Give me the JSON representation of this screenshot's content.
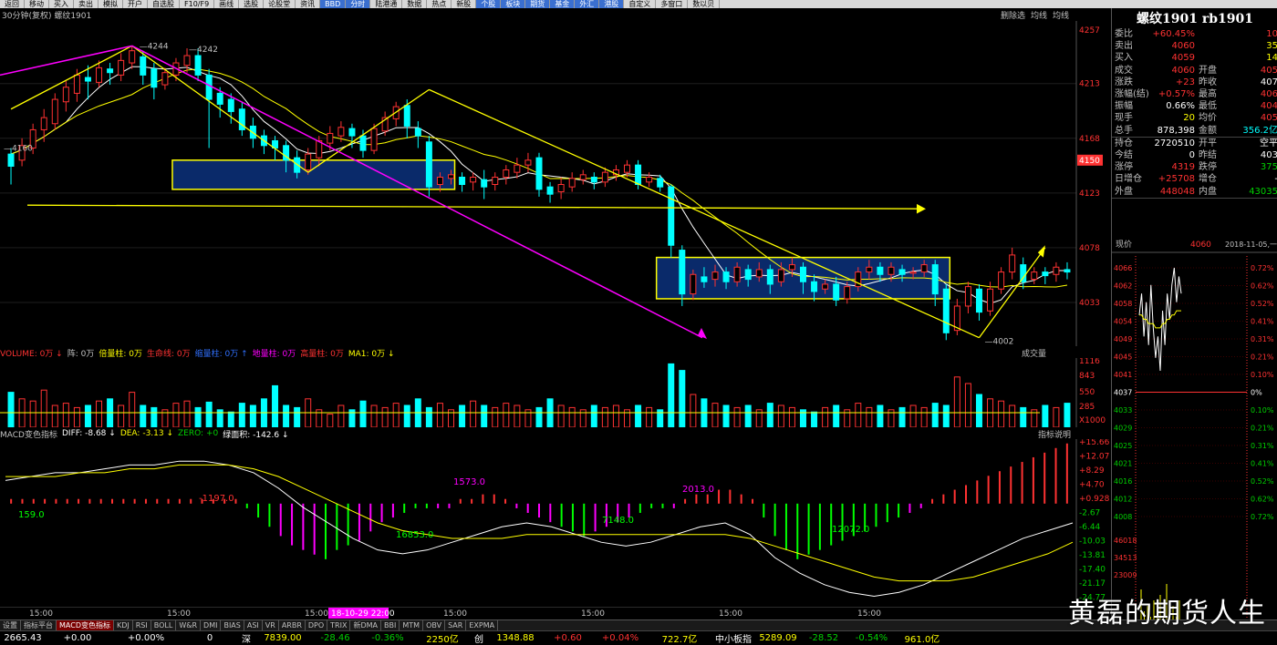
{
  "toolbar": {
    "items": [
      "返回",
      "移动",
      "买入",
      "卖出",
      "模拟",
      "开户",
      "自选股",
      "F10/F9",
      "画线",
      "选股",
      "论股堂",
      "资讯",
      "BBD",
      "分时",
      "陆港通",
      "数据",
      "热点",
      "新股",
      "个股",
      "板块",
      "期货",
      "基金",
      "外汇",
      "港股",
      "自定义",
      "多窗口",
      "数以贝"
    ],
    "highlight": [
      "BBD",
      "分时",
      "个股",
      "板块",
      "期货",
      "基金",
      "外汇",
      "港股"
    ]
  },
  "chart_header": {
    "title": "30分钟(复权)  螺纹1901",
    "right": [
      "删除选",
      "均线",
      "均线"
    ]
  },
  "price_axis": {
    "ticks": [
      "4257",
      "4213",
      "4168",
      "4150",
      "4123",
      "4078",
      "4033"
    ],
    "current": "4150"
  },
  "kline": {
    "labels": {
      "hi1": "4244",
      "hi2": "4242",
      "lo1": "4160",
      "lo2": "4002"
    },
    "candles": [
      [
        4145,
        4155,
        4130,
        4160,
        "d"
      ],
      [
        4150,
        4162,
        4145,
        4168,
        "u"
      ],
      [
        4160,
        4175,
        4155,
        4180,
        "u"
      ],
      [
        4175,
        4185,
        4165,
        4192,
        "u"
      ],
      [
        4180,
        4200,
        4175,
        4205,
        "u"
      ],
      [
        4198,
        4210,
        4190,
        4215,
        "u"
      ],
      [
        4205,
        4220,
        4198,
        4225,
        "u"
      ],
      [
        4215,
        4218,
        4200,
        4228,
        "d"
      ],
      [
        4214,
        4226,
        4210,
        4232,
        "u"
      ],
      [
        4222,
        4225,
        4212,
        4230,
        "d"
      ],
      [
        4220,
        4232,
        4215,
        4238,
        "u"
      ],
      [
        4230,
        4240,
        4225,
        4244,
        "u"
      ],
      [
        4235,
        4220,
        4212,
        4240,
        "d"
      ],
      [
        4225,
        4210,
        4200,
        4230,
        "d"
      ],
      [
        4212,
        4222,
        4208,
        4226,
        "u"
      ],
      [
        4220,
        4230,
        4215,
        4234,
        "u"
      ],
      [
        4228,
        4236,
        4222,
        4242,
        "u"
      ],
      [
        4236,
        4220,
        4215,
        4242,
        "d"
      ],
      [
        4220,
        4200,
        4160,
        4225,
        "d"
      ],
      [
        4205,
        4196,
        4185,
        4210,
        "d"
      ],
      [
        4200,
        4190,
        4180,
        4205,
        "d"
      ],
      [
        4192,
        4175,
        4170,
        4198,
        "d"
      ],
      [
        4178,
        4168,
        4160,
        4185,
        "d"
      ],
      [
        4170,
        4162,
        4155,
        4175,
        "d"
      ],
      [
        4166,
        4160,
        4150,
        4170,
        "d"
      ],
      [
        4162,
        4150,
        4140,
        4166,
        "d"
      ],
      [
        4152,
        4140,
        4135,
        4158,
        "d"
      ],
      [
        4142,
        4155,
        4138,
        4160,
        "u"
      ],
      [
        4152,
        4166,
        4145,
        4170,
        "u"
      ],
      [
        4164,
        4172,
        4158,
        4178,
        "u"
      ],
      [
        4170,
        4177,
        4165,
        4182,
        "u"
      ],
      [
        4176,
        4170,
        4160,
        4180,
        "d"
      ],
      [
        4170,
        4158,
        4152,
        4175,
        "d"
      ],
      [
        4158,
        4176,
        4155,
        4180,
        "u"
      ],
      [
        4174,
        4185,
        4170,
        4190,
        "u"
      ],
      [
        4184,
        4194,
        4178,
        4198,
        "u"
      ],
      [
        4195,
        4178,
        4168,
        4200,
        "d"
      ],
      [
        4176,
        4170,
        4160,
        4182,
        "d"
      ],
      [
        4165,
        4128,
        4120,
        4170,
        "d"
      ],
      [
        4130,
        4136,
        4124,
        4140,
        "u"
      ],
      [
        4135,
        4138,
        4130,
        4142,
        "u"
      ],
      [
        4136,
        4130,
        4124,
        4140,
        "d"
      ],
      [
        4132,
        4136,
        4125,
        4140,
        "u"
      ],
      [
        4134,
        4128,
        4118,
        4142,
        "d"
      ],
      [
        4130,
        4136,
        4125,
        4140,
        "u"
      ],
      [
        4136,
        4142,
        4130,
        4146,
        "u"
      ],
      [
        4140,
        4146,
        4135,
        4152,
        "u"
      ],
      [
        4146,
        4150,
        4140,
        4156,
        "u"
      ],
      [
        4152,
        4126,
        4120,
        4156,
        "d"
      ],
      [
        4128,
        4122,
        4115,
        4132,
        "d"
      ],
      [
        4124,
        4130,
        4118,
        4136,
        "u"
      ],
      [
        4128,
        4135,
        4124,
        4140,
        "u"
      ],
      [
        4134,
        4138,
        4130,
        4142,
        "u"
      ],
      [
        4136,
        4132,
        4126,
        4140,
        "d"
      ],
      [
        4132,
        4140,
        4128,
        4144,
        "u"
      ],
      [
        4138,
        4142,
        4133,
        4146,
        "u"
      ],
      [
        4140,
        4146,
        4136,
        4150,
        "u"
      ],
      [
        4146,
        4130,
        4126,
        4150,
        "d"
      ],
      [
        4132,
        4136,
        4128,
        4140,
        "u"
      ],
      [
        4135,
        4128,
        4124,
        4138,
        "d"
      ],
      [
        4128,
        4080,
        4070,
        4130,
        "d"
      ],
      [
        4076,
        4040,
        4030,
        4080,
        "d"
      ],
      [
        4040,
        4056,
        4035,
        4060,
        "u"
      ],
      [
        4054,
        4050,
        4045,
        4062,
        "d"
      ],
      [
        4052,
        4058,
        4046,
        4064,
        "u"
      ],
      [
        4058,
        4050,
        4044,
        4062,
        "d"
      ],
      [
        4050,
        4062,
        4046,
        4066,
        "u"
      ],
      [
        4060,
        4052,
        4046,
        4064,
        "d"
      ],
      [
        4054,
        4060,
        4050,
        4066,
        "u"
      ],
      [
        4060,
        4048,
        4040,
        4064,
        "d"
      ],
      [
        4050,
        4060,
        4046,
        4066,
        "u"
      ],
      [
        4060,
        4064,
        4054,
        4070,
        "u"
      ],
      [
        4062,
        4050,
        4040,
        4066,
        "d"
      ],
      [
        4050,
        4042,
        4034,
        4056,
        "d"
      ],
      [
        4044,
        4048,
        4040,
        4052,
        "u"
      ],
      [
        4048,
        4035,
        4030,
        4054,
        "d"
      ],
      [
        4036,
        4046,
        4032,
        4050,
        "u"
      ],
      [
        4046,
        4058,
        4042,
        4062,
        "u"
      ],
      [
        4058,
        4062,
        4052,
        4068,
        "u"
      ],
      [
        4062,
        4056,
        4050,
        4066,
        "d"
      ],
      [
        4056,
        4062,
        4050,
        4066,
        "u"
      ],
      [
        4060,
        4056,
        4050,
        4064,
        "d"
      ],
      [
        4057,
        4058,
        4052,
        4062,
        "u"
      ],
      [
        4058,
        4064,
        4054,
        4068,
        "u"
      ],
      [
        4064,
        4040,
        4030,
        4068,
        "d"
      ],
      [
        4044,
        4008,
        4002,
        4048,
        "d"
      ],
      [
        4010,
        4030,
        4006,
        4036,
        "u"
      ],
      [
        4030,
        4046,
        4024,
        4050,
        "u"
      ],
      [
        4044,
        4025,
        4018,
        4048,
        "d"
      ],
      [
        4026,
        4044,
        4022,
        4050,
        "u"
      ],
      [
        4044,
        4058,
        4040,
        4062,
        "u"
      ],
      [
        4058,
        4072,
        4052,
        4078,
        "u"
      ],
      [
        4064,
        4050,
        4044,
        4070,
        "d"
      ],
      [
        4052,
        4058,
        4048,
        4062,
        "u"
      ],
      [
        4058,
        4055,
        4048,
        4062,
        "d"
      ],
      [
        4056,
        4062,
        4050,
        4066,
        "u"
      ],
      [
        4060,
        4058,
        4052,
        4066,
        "d"
      ]
    ],
    "ylim": [
      4000,
      4260
    ]
  },
  "volume": {
    "label": {
      "items": [
        "VOLUME: 0万 ↓",
        "阵: 0万",
        "倍量柱: 0万",
        "生命线: 0万",
        "缩量柱: 0万 ↑",
        "地量柱: 0万",
        "高量柱: 0万",
        "MA1: 0万 ↓"
      ]
    },
    "ticks": [
      "1116",
      "843",
      "550",
      "285",
      "X1000"
    ],
    "side_label": "成交量",
    "bars": [
      320,
      260,
      240,
      340,
      200,
      220,
      180,
      200,
      240,
      260,
      200,
      320,
      200,
      180,
      160,
      220,
      240,
      180,
      230,
      160,
      140,
      220,
      200,
      260,
      380,
      200,
      180,
      260,
      160,
      120,
      200,
      160,
      240,
      200,
      180,
      220,
      200,
      260,
      180,
      220,
      160,
      200,
      240,
      200,
      180,
      220,
      200,
      160,
      180,
      260,
      200,
      180,
      160,
      200,
      180,
      200,
      160,
      200,
      180,
      160,
      580,
      520,
      300,
      260,
      220,
      200,
      180,
      200,
      160,
      220,
      200,
      180,
      160,
      140,
      180,
      200,
      160,
      220,
      180,
      200,
      160,
      180,
      200,
      180,
      220,
      200,
      460,
      400,
      300,
      260,
      240,
      200,
      180,
      160,
      200,
      180,
      220,
      200,
      160,
      140
    ],
    "max": 600,
    "ma": 200
  },
  "macd": {
    "label": {
      "name": "MACD变色指标",
      "diff": "DIFF: -8.68 ↓",
      "dea": "DEA: -3.13 ↓",
      "zero": "ZERO: +0",
      "area": "绿面积: -142.6 ↓"
    },
    "ticks": [
      "+15.66",
      "+12.07",
      "+8.29",
      "+4.70",
      "+0.928",
      "-2.67",
      "-6.44",
      "-10.03",
      "-13.81",
      "-17.40",
      "-21.17",
      "-24.77"
    ],
    "side_label": "指标说明",
    "annotations": [
      "159.0",
      "-1197.0",
      "1573.0",
      "16853.0",
      "7148.0",
      "2013.0",
      "12072.0"
    ],
    "hist": [
      1,
      1,
      1,
      1,
      1,
      1,
      1,
      1,
      1,
      1,
      1,
      1,
      1,
      1,
      1,
      1,
      1,
      1,
      1,
      1,
      1,
      -1,
      -3,
      -5,
      -7,
      -9,
      -10,
      -11,
      -12,
      -10,
      -9,
      -8,
      -6,
      -4,
      -3,
      -2,
      -1,
      -1,
      -1,
      -1,
      1,
      1,
      2,
      2,
      1,
      -1,
      -2,
      -3,
      -4,
      -5,
      -6,
      -7,
      -6,
      -5,
      -4,
      -3,
      -2,
      -1,
      -1,
      -1,
      1,
      2,
      2,
      3,
      3,
      2,
      1,
      -3,
      -7,
      -10,
      -12,
      -11,
      -10,
      -9,
      -8,
      -7,
      -6,
      -5,
      -4,
      -3,
      -2,
      -1,
      1,
      2,
      3,
      4,
      5,
      6,
      7,
      8,
      9,
      10,
      11,
      12,
      13
    ],
    "diff": [
      6,
      7,
      8,
      8,
      9,
      10,
      10,
      11,
      11,
      10,
      8,
      4,
      -1,
      -5,
      -9,
      -12,
      -13,
      -12,
      -10,
      -8,
      -6,
      -5,
      -6,
      -8,
      -10,
      -11,
      -10,
      -8,
      -6,
      -5,
      -8,
      -14,
      -18,
      -21,
      -23,
      -24,
      -23,
      -21,
      -18,
      -15,
      -12,
      -9,
      -7,
      -5
    ],
    "dea": [
      7,
      7,
      7,
      8,
      8,
      9,
      9,
      10,
      10,
      10,
      9,
      7,
      4,
      1,
      -2,
      -5,
      -7,
      -8,
      -9,
      -9,
      -9,
      -8,
      -8,
      -8,
      -8,
      -8,
      -8,
      -8,
      -8,
      -8,
      -9,
      -11,
      -13,
      -15,
      -17,
      -19,
      -20,
      -20,
      -20,
      -19,
      -17,
      -15,
      -13,
      -10
    ],
    "ylim": [
      -26,
      16
    ]
  },
  "time_axis": {
    "labels": [
      "15:00",
      "15:00",
      "15:00",
      "15:00",
      "15:00",
      "15:00",
      "15:00"
    ],
    "cursor": "18-10-29 22:00"
  },
  "info": {
    "title": "螺纹1901 rb1901",
    "rows": [
      {
        "k": "委比",
        "v": "+60.45%",
        "vc": "red",
        "k2": "",
        "v2": "10",
        "v2c": "red"
      },
      {
        "k": "卖出",
        "v": "4060",
        "vc": "red",
        "k2": "",
        "v2": "35",
        "v2c": "yel"
      },
      {
        "k": "买入",
        "v": "4059",
        "vc": "red",
        "k2": "",
        "v2": "14",
        "v2c": "yel"
      },
      {
        "k": "成交",
        "v": "4060",
        "vc": "red",
        "k2": "开盘",
        "v2": "405",
        "v2c": "red"
      },
      {
        "k": "涨跌",
        "v": "+23",
        "vc": "red",
        "k2": "昨收",
        "v2": "407",
        "v2c": "wht"
      },
      {
        "k": "涨幅(结)",
        "v": "+0.57%",
        "vc": "red",
        "k2": "最高",
        "v2": "406",
        "v2c": "red"
      },
      {
        "k": "振幅",
        "v": "0.66%",
        "vc": "wht",
        "k2": "最低",
        "v2": "404",
        "v2c": "red"
      },
      {
        "k": "现手",
        "v": "20",
        "vc": "yel",
        "k2": "均价",
        "v2": "405",
        "v2c": "red"
      },
      {
        "k": "总手",
        "v": "878,398",
        "vc": "wht",
        "k2": "金额",
        "v2": "356.2亿",
        "v2c": "cyan"
      },
      {
        "k": "持仓",
        "v": "2720510",
        "vc": "wht",
        "k2": "开平",
        "v2": "空平",
        "v2c": "wht"
      },
      {
        "k": "今结",
        "v": "0",
        "vc": "wht",
        "k2": "昨结",
        "v2": "403",
        "v2c": "wht"
      },
      {
        "k": "涨停",
        "v": "4319",
        "vc": "red",
        "k2": "跌停",
        "v2": "375",
        "v2c": "green"
      },
      {
        "k": "日增仓",
        "v": "+25708",
        "vc": "red",
        "k2": "增仓",
        "v2": "-",
        "v2c": "wht"
      },
      {
        "k": "外盘",
        "v": "448048",
        "vc": "red",
        "k2": "内盘",
        "v2": "43035",
        "v2c": "green"
      }
    ]
  },
  "mini": {
    "header": {
      "label": "现价",
      "price": "4060",
      "date": "2018-11-05,一"
    },
    "left_ticks": [
      "4066",
      "4062",
      "4058",
      "4054",
      "4049",
      "4045",
      "4041",
      "4037",
      "4033",
      "4029",
      "4025",
      "4021",
      "4016",
      "4012",
      "4008"
    ],
    "right_ticks": [
      "0.72%",
      "0.62%",
      "0.52%",
      "0.41%",
      "0.31%",
      "0.21%",
      "0.10%",
      "0%",
      "0.10%",
      "0.21%",
      "0.31%",
      "0.41%",
      "0.52%",
      "0.62%",
      "0.72%"
    ],
    "vol_ticks": [
      "46018",
      "34513",
      "23009"
    ],
    "price_line": [
      4055,
      4060,
      4050,
      4058,
      4048,
      4062,
      4052,
      4045,
      4050,
      4042,
      4056,
      4048,
      4060,
      4054,
      4062,
      4066,
      4058,
      4064,
      4060
    ],
    "avg_line": [
      4055,
      4055,
      4054,
      4054,
      4053,
      4053,
      4053,
      4052,
      4052,
      4052,
      4053,
      4053,
      4054,
      4054,
      4055,
      4055,
      4056,
      4056,
      4056
    ],
    "vol": [
      0.7,
      0.3,
      0.4,
      0.2,
      0.5,
      0.3,
      0.6,
      0.2,
      0.8,
      0.3,
      0.4,
      0.2,
      0.5
    ]
  },
  "tabs": {
    "items": [
      "设置",
      "指标平台",
      "MACD变色指标",
      "KDJ",
      "RSI",
      "BOLL",
      "W&R",
      "DMI",
      "BIAS",
      "ASI",
      "VR",
      "ARBR",
      "DPO",
      "TRIX",
      "新DMA",
      "BBI",
      "MTM",
      "OBV",
      "SAR",
      "EXPMA"
    ],
    "active": "MACD变色指标"
  },
  "status": [
    {
      "t": "2665.43",
      "c": "wht"
    },
    {
      "t": "+0.00",
      "c": "wht"
    },
    {
      "t": "+0.00%",
      "c": "wht"
    },
    {
      "t": "0",
      "c": "wht"
    },
    {
      "t": "深",
      "c": "wht"
    },
    {
      "t": "7839.00",
      "c": "yel"
    },
    {
      "t": "-28.46",
      "c": "green"
    },
    {
      "t": "-0.36%",
      "c": "green"
    },
    {
      "t": "2250亿",
      "c": "yel"
    },
    {
      "t": "创",
      "c": "wht"
    },
    {
      "t": "1348.88",
      "c": "yel"
    },
    {
      "t": "+0.60",
      "c": "red"
    },
    {
      "t": "+0.04%",
      "c": "red"
    },
    {
      "t": "722.7亿",
      "c": "yel"
    },
    {
      "t": "中小板指",
      "c": "wht"
    },
    {
      "t": "5289.09",
      "c": "yel"
    },
    {
      "t": "-28.52",
      "c": "green"
    },
    {
      "t": "-0.54%",
      "c": "green"
    },
    {
      "t": "961.0亿",
      "c": "yel"
    }
  ],
  "watermark": "黄磊的期货人生",
  "colors": {
    "up": "#ff3232",
    "down": "#00ffff",
    "ma_yellow": "#ffff00",
    "ma_white": "#ffffff",
    "trend_magenta": "#ff00ff",
    "box_fill": "#0a2a6a"
  }
}
